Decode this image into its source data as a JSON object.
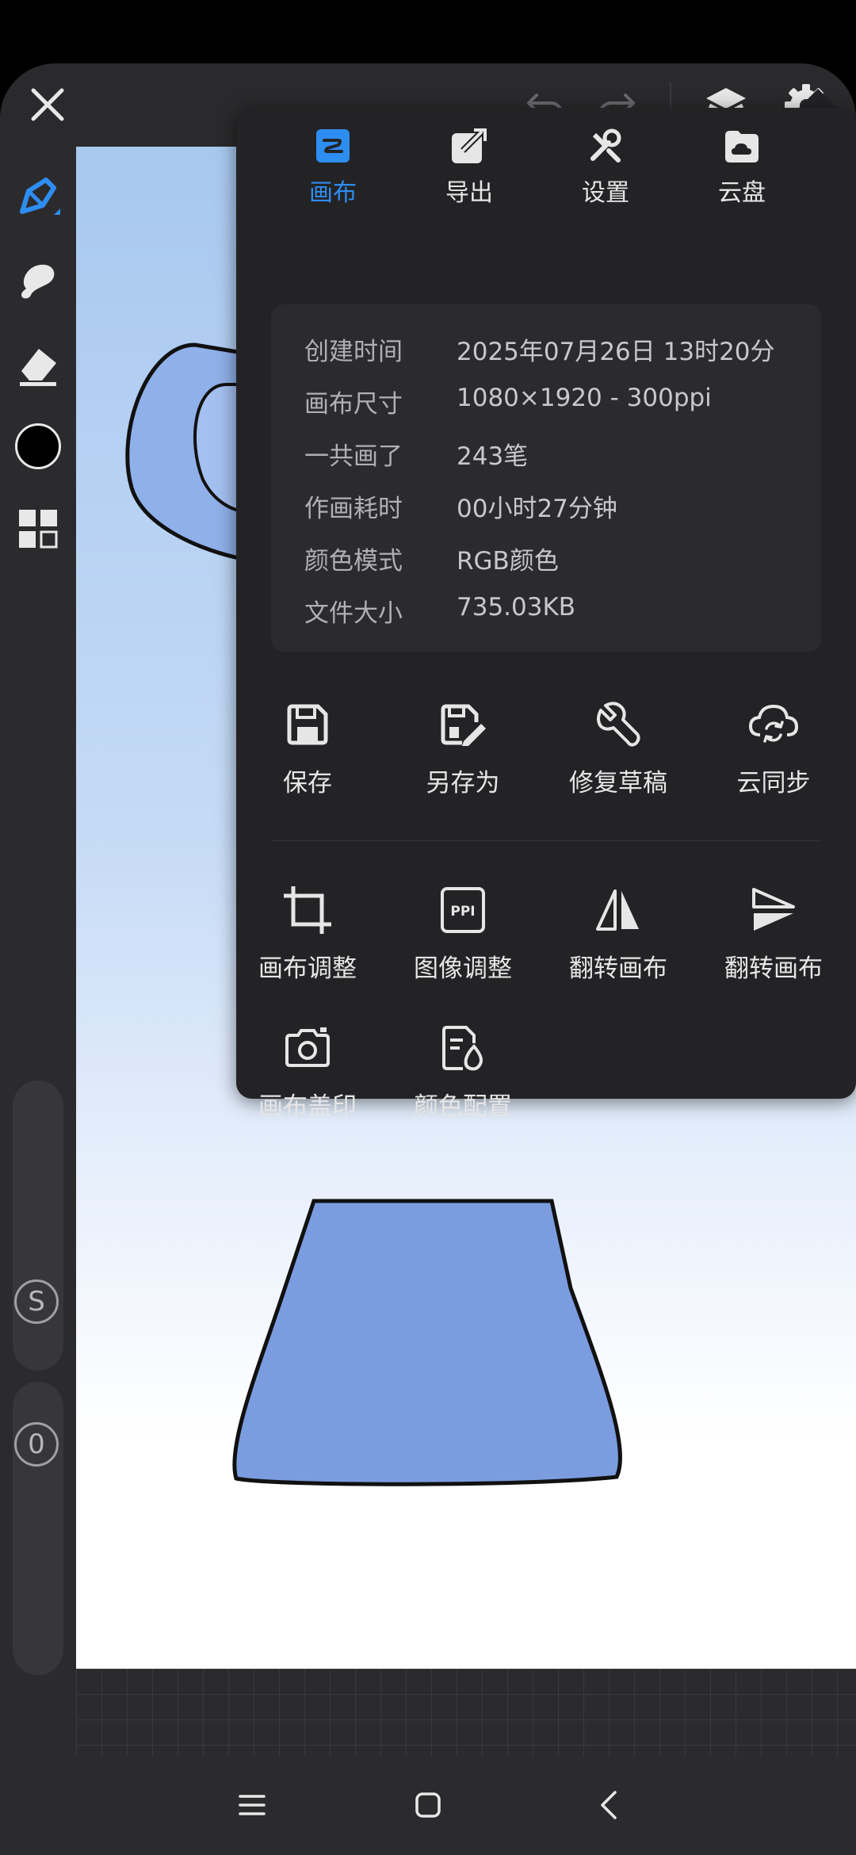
{
  "tabs": [
    {
      "label": "画布",
      "icon": "canvas-icon",
      "active": true
    },
    {
      "label": "导出",
      "icon": "export-icon"
    },
    {
      "label": "设置",
      "icon": "tools-icon"
    },
    {
      "label": "云盘",
      "icon": "cloud-drive-icon"
    }
  ],
  "info": [
    {
      "key": "创建时间",
      "value": "2025年07月26日 13时20分"
    },
    {
      "key": "画布尺寸",
      "value": "1080×1920 - 300ppi"
    },
    {
      "key": "一共画了",
      "value": "243笔"
    },
    {
      "key": "作画耗时",
      "value": "00小时27分钟"
    },
    {
      "key": "颜色模式",
      "value": "RGB颜色"
    },
    {
      "key": "文件大小",
      "value": "735.03KB"
    }
  ],
  "actions_row1": [
    {
      "label": "保存",
      "icon": "save-icon"
    },
    {
      "label": "另存为",
      "icon": "save-as-icon"
    },
    {
      "label": "修复草稿",
      "icon": "wrench-icon"
    },
    {
      "label": "云同步",
      "icon": "cloud-sync-icon"
    }
  ],
  "actions_row2": [
    {
      "label": "画布调整",
      "icon": "crop-icon"
    },
    {
      "label": "图像调整",
      "icon": "ppi-icon"
    },
    {
      "label": "翻转画布",
      "icon": "flip-horizontal-icon"
    },
    {
      "label": "翻转画布",
      "icon": "flip-vertical-icon"
    }
  ],
  "actions_row3": [
    {
      "label": "画布盖印",
      "icon": "camera-icon"
    },
    {
      "label": "颜色配置",
      "icon": "color-profile-icon"
    }
  ],
  "sidebar": {
    "s_label": "S",
    "o_label": "0",
    "current_color": "#000000"
  },
  "colors": {
    "accent": "#2e8df0",
    "fill_blue": "#7b9de0"
  }
}
